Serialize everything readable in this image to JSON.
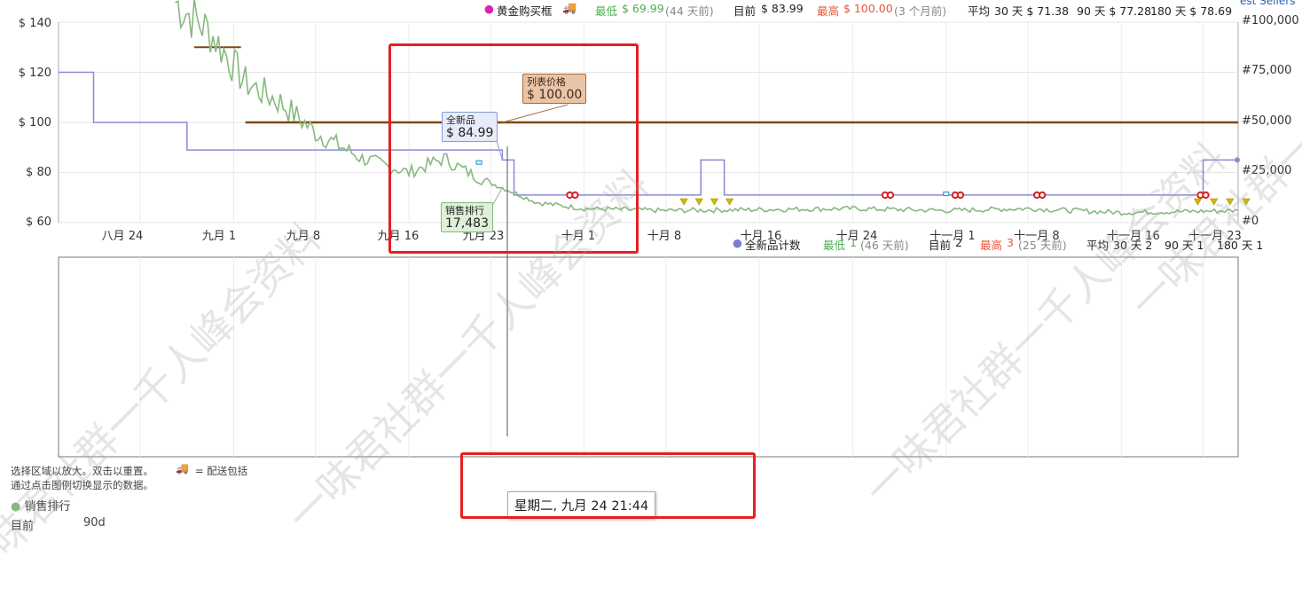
{
  "legend_top": {
    "buybox_label": "黄金购买框",
    "lowest_label": "最低",
    "lowest_value": "$ 69.99",
    "lowest_when": "(44 天前)",
    "current_label": "目前",
    "current_value": "$ 83.99",
    "highest_label": "最高",
    "highest_value": "$ 100.00",
    "highest_when": "(3 个月前)",
    "avg_label": "平均",
    "avg30": "30 天 $ 71.38",
    "avg90": "90 天 $ 77.28",
    "avg180": "180 天 $ 78.69",
    "corner_link": "est Sellers"
  },
  "legend_mid": {
    "series_label": "全新品计数",
    "lowest_label": "最低",
    "lowest_value": "1",
    "lowest_when": "(46 天前)",
    "current_label": "目前",
    "current_value": "2",
    "highest_label": "最高",
    "highest_value": "3",
    "highest_when": "(25 天前)",
    "avg_label": "平均",
    "avg30": "30 天 2",
    "avg90": "90 天 1",
    "avg180": "180 天 1"
  },
  "tooltips": {
    "list_price_label": "列表价格",
    "list_price_value": "$ 100.00",
    "new_label": "全新品",
    "new_value": "$ 84.99",
    "rank_label": "销售排行",
    "rank_value": "17,483"
  },
  "hover_date": "星期二, 九月 24 21:44",
  "hints": {
    "line1": "选择区域以放大。双击以重置。",
    "line1b": "= 配送包括",
    "line2": "通过点击图例切换显示的数据。",
    "rank_legend": "销售排行",
    "current_label": "目前",
    "current_value": "90d"
  },
  "watermark": "一味君社群一千人峰会资料",
  "colors": {
    "list_price": "#7a4a12",
    "new_price": "#8a8ad6",
    "sales_rank": "#86b97e",
    "amazon_dot": "#d62020",
    "shipping": "#d4b800",
    "highlight": "#e81f1f"
  },
  "chart_data": [
    {
      "type": "line",
      "title": "",
      "y_left_ticks": [
        "$ 140",
        "$ 120",
        "$ 100",
        "$ 80",
        "$ 60"
      ],
      "y_right_ticks": [
        "#100,000",
        "#75,000",
        "#50,000",
        "#25,000",
        "#0"
      ],
      "x_ticks": [
        "八月 24",
        "九月 1",
        "九月 8",
        "九月 16",
        "九月 23",
        "十月 1",
        "十月 8",
        "十月 16",
        "十月 24",
        "十一月 1",
        "十一月 8",
        "十一月 16",
        "十一月 23"
      ],
      "ylim": [
        60,
        140
      ],
      "series": [
        {
          "name": "列表价格",
          "x": [
            "八月 29",
            "九月 2",
            "十一月 26"
          ],
          "values": [
            130,
            100,
            100
          ]
        },
        {
          "name": "全新品",
          "x": [
            "八月 17",
            "八月 18",
            "八月 20",
            "八月 28",
            "九月 22",
            "九月 24",
            "九月 25",
            "十月 10",
            "十月 11",
            "十月 13",
            "十一月 22",
            "十一月 23",
            "十一月 26"
          ],
          "values": [
            120,
            120,
            100,
            89,
            89,
            85,
            71,
            71,
            85,
            71,
            71,
            85,
            85
          ]
        },
        {
          "name": "销售排行",
          "x": [
            "八月 27",
            "八月 30",
            "九月 2",
            "九月 5",
            "九月 8",
            "九月 12",
            "九月 16",
            "九月 19",
            "九月 22",
            "九月 24",
            "九月 27",
            "十月 1",
            "十月 8",
            "十月 16",
            "十月 24",
            "十一月 1",
            "十一月 8",
            "十一月 16",
            "十一月 26"
          ],
          "values": [
            110000,
            95000,
            70000,
            60000,
            45000,
            32000,
            25000,
            32000,
            22000,
            17483,
            10000,
            7000,
            6000,
            6500,
            7000,
            6000,
            7000,
            5000,
            6000
          ]
        }
      ]
    },
    {
      "type": "line",
      "title": "",
      "series": [
        {
          "name": "全新品计数",
          "lowest": 1,
          "current": 2,
          "highest": 3
        }
      ]
    }
  ]
}
